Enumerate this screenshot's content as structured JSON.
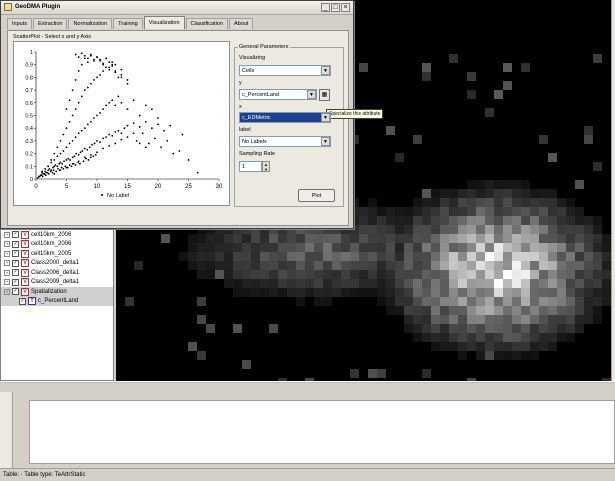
{
  "dialog": {
    "title": "GeoDMA Plugin",
    "tabs": [
      "Inputs",
      "Extraction",
      "Normalization",
      "Training",
      "Visualization",
      "Classification",
      "About"
    ],
    "active_tab": "Visualization",
    "minimize_glyph": "_",
    "maximize_glyph": "□",
    "close_glyph": "×"
  },
  "scatter": {
    "title": "ScatterPlot - Select x and y Axis",
    "legend_label": "No Label"
  },
  "params": {
    "group_title": "General Parameters",
    "visualizing_label": "Visualizing",
    "visualizing_value": "Cells",
    "y_label": "y",
    "y_value": "c_PercentLand",
    "x_label": "x",
    "x_value": "c_EDMetric",
    "label_label": "label",
    "label_value": "No Labels",
    "rate_label": "Sampling Rate",
    "rate_value": "1",
    "plot_button": "Plot",
    "specialize_tooltip": "Specialize this attribute"
  },
  "layers": [
    {
      "name": "cell10km_2006",
      "type": "V",
      "checked": true
    },
    {
      "name": "cell10km_2006",
      "type": "V",
      "checked": true
    },
    {
      "name": "cell10km_2005",
      "type": "V",
      "checked": true
    },
    {
      "name": "Class2000_delta1",
      "type": "V",
      "checked": true
    },
    {
      "name": "Class2006_delta1",
      "type": "V",
      "checked": true
    },
    {
      "name": "Class2009_delta1",
      "type": "V",
      "checked": true
    },
    {
      "name": "Spatialization",
      "type": "V",
      "checked": true
    },
    {
      "name": "c_PercentLand",
      "type": "T",
      "checked": true
    }
  ],
  "status": {
    "text": "Table: · Table type: TeAttrStatic"
  },
  "chart_data": {
    "type": "scatter",
    "title": "",
    "xlabel": "",
    "ylabel": "",
    "xlim": [
      0,
      30
    ],
    "ylim": [
      0,
      1
    ],
    "x_ticks": [
      0,
      5,
      10,
      15,
      20,
      25,
      30
    ],
    "y_ticks": [
      0,
      0.1,
      0.2,
      0.3,
      0.4,
      0.5,
      0.6,
      0.7,
      0.8,
      0.9,
      1
    ],
    "y_tick_labels": [
      "0",
      "0.1",
      "0.2",
      "0.3",
      "0.4",
      "0.5",
      "0.6",
      "0.7",
      "0.8",
      "0.9",
      "1"
    ],
    "grid": false,
    "legend": "bottom",
    "marker_color": "#000000",
    "series": [
      {
        "name": "No Label",
        "x": [
          0.5,
          0.8,
          1.0,
          1.2,
          1.5,
          1.7,
          2.0,
          2.2,
          2.5,
          2.8,
          3.0,
          3.2,
          3.5,
          3.8,
          4.0,
          4.3,
          4.6,
          5.0,
          5.3,
          5.6,
          6.0,
          6.3,
          6.6,
          7.0,
          7.3,
          7.6,
          8.0,
          8.4,
          8.8,
          9.2,
          9.6,
          10.0,
          10.5,
          11.0,
          11.5,
          12.0,
          12.5,
          13.0,
          13.5,
          14.0,
          14.5,
          15.0,
          16.0,
          17.0,
          18.0,
          19.0,
          20.0,
          21.0,
          22.0,
          24.0,
          1.0,
          1.5,
          2.0,
          2.5,
          3.0,
          3.5,
          4.0,
          4.5,
          5.0,
          5.5,
          6.0,
          6.5,
          7.0,
          7.5,
          8.0,
          8.5,
          9.0,
          9.5,
          10.0,
          10.5,
          11.0,
          11.5,
          12.0,
          12.5,
          13.0,
          13.5,
          14.0,
          15.0,
          16.0,
          17.0,
          18.0,
          19.0,
          20.0,
          2.0,
          2.5,
          3.0,
          3.5,
          4.0,
          4.5,
          5.0,
          5.5,
          6.0,
          6.5,
          7.0,
          7.5,
          8.0,
          8.5,
          9.0,
          9.5,
          10.0,
          10.5,
          11.0,
          11.5,
          12.0,
          12.5,
          13.0,
          14.0,
          15.0,
          5.0,
          5.5,
          6.0,
          6.5,
          7.0,
          7.5,
          8.0,
          8.5,
          9.0,
          9.5,
          10.0,
          10.5,
          11.0,
          11.5,
          12.0,
          12.5,
          13.0,
          13.5,
          14.0,
          15.0,
          6.5,
          7.0,
          7.5,
          8.0,
          8.5,
          9.0,
          9.5,
          10.0,
          10.5,
          11.0,
          11.5,
          12.0,
          12.5,
          13.0,
          14.0,
          0.3,
          0.6,
          0.9,
          1.1,
          1.4,
          1.6,
          1.9,
          2.1,
          2.4,
          2.7,
          2.9,
          3.3,
          3.6,
          3.9,
          4.2,
          4.5,
          4.8,
          5.2,
          5.5,
          5.8,
          6.2,
          6.5,
          6.9,
          7.2,
          7.8,
          8.2,
          8.6,
          9.0,
          9.4,
          9.8,
          16.5,
          17.5,
          18.5,
          19.5,
          20.5,
          21.5,
          22.5,
          23.5,
          25.0,
          26.5,
          3.0,
          4.0,
          5.0,
          6.0,
          7.0,
          8.0,
          9.0,
          10.0,
          11.0,
          12.0,
          13.0,
          14.0,
          15.0,
          16.0,
          17.0,
          18.0
        ],
        "y": [
          0.02,
          0.03,
          0.05,
          0.04,
          0.06,
          0.05,
          0.07,
          0.08,
          0.07,
          0.09,
          0.1,
          0.11,
          0.1,
          0.12,
          0.13,
          0.12,
          0.14,
          0.15,
          0.16,
          0.15,
          0.17,
          0.18,
          0.2,
          0.19,
          0.21,
          0.22,
          0.24,
          0.23,
          0.25,
          0.27,
          0.28,
          0.3,
          0.29,
          0.32,
          0.33,
          0.35,
          0.34,
          0.37,
          0.38,
          0.36,
          0.4,
          0.42,
          0.44,
          0.41,
          0.45,
          0.4,
          0.43,
          0.38,
          0.42,
          0.35,
          0.06,
          0.08,
          0.1,
          0.13,
          0.15,
          0.18,
          0.2,
          0.22,
          0.25,
          0.28,
          0.3,
          0.33,
          0.36,
          0.38,
          0.4,
          0.43,
          0.45,
          0.48,
          0.5,
          0.52,
          0.55,
          0.58,
          0.6,
          0.62,
          0.58,
          0.65,
          0.6,
          0.55,
          0.62,
          0.5,
          0.58,
          0.55,
          0.48,
          0.1,
          0.15,
          0.2,
          0.25,
          0.3,
          0.35,
          0.4,
          0.45,
          0.5,
          0.55,
          0.6,
          0.65,
          0.7,
          0.72,
          0.75,
          0.78,
          0.8,
          0.82,
          0.85,
          0.88,
          0.86,
          0.9,
          0.84,
          0.8,
          0.78,
          0.55,
          0.62,
          0.7,
          0.78,
          0.85,
          0.9,
          0.95,
          0.92,
          0.97,
          0.94,
          0.96,
          0.93,
          0.9,
          0.95,
          0.88,
          0.92,
          0.85,
          0.8,
          0.82,
          0.75,
          0.98,
          0.96,
          0.99,
          0.97,
          0.95,
          0.98,
          0.93,
          0.96,
          0.94,
          0.91,
          0.95,
          0.92,
          0.89,
          0.9,
          0.86,
          0.01,
          0.02,
          0.03,
          0.02,
          0.04,
          0.03,
          0.05,
          0.04,
          0.06,
          0.05,
          0.07,
          0.06,
          0.08,
          0.07,
          0.09,
          0.08,
          0.1,
          0.09,
          0.11,
          0.1,
          0.12,
          0.11,
          0.13,
          0.12,
          0.14,
          0.16,
          0.15,
          0.17,
          0.18,
          0.19,
          0.3,
          0.36,
          0.28,
          0.32,
          0.25,
          0.3,
          0.2,
          0.22,
          0.15,
          0.05,
          0.04,
          0.07,
          0.09,
          0.12,
          0.14,
          0.17,
          0.19,
          0.21,
          0.24,
          0.26,
          0.28,
          0.31,
          0.33,
          0.36,
          0.28,
          0.25
        ]
      }
    ]
  }
}
